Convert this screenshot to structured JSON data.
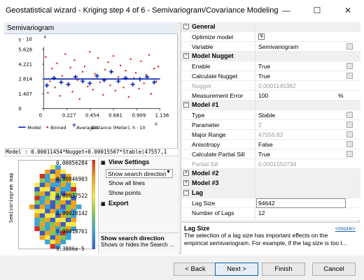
{
  "window": {
    "title": "Geostatistical wizard - Kriging step 4 of 6 - Semivariogram/Covariance Modeling",
    "controls": {
      "minimize": "—",
      "maximize": "☐",
      "close": "✕"
    }
  },
  "semivariogram_panel": {
    "header": "Semivariogram",
    "y_scale": "γ · 10",
    "y_exp": "4",
    "x_scale": "Distance (Meter), h · 10",
    "x_exp": "-6",
    "legend": {
      "model": "Model",
      "binned": "Binned",
      "averaged": "Averaged"
    },
    "model_equation": "Model : 0.00011454*Nugget+0.00015507*Stable(47557,1",
    "chart_data": {
      "type": "scatter",
      "y_ticks": [
        "5.628",
        "4.221",
        "2.814",
        "1.407",
        "0"
      ],
      "x_ticks": [
        "0",
        "0.227",
        "0.454",
        "0.681",
        "0.909",
        "1.136"
      ],
      "model_value": 2.814,
      "xlim": [
        0,
        1.136
      ],
      "ylim": [
        0,
        5.628
      ],
      "binned": [
        {
          "x": 0.02,
          "y": 4.9
        },
        {
          "x": 0.04,
          "y": 1.5
        },
        {
          "x": 0.06,
          "y": 2.6
        },
        {
          "x": 0.08,
          "y": 3.8
        },
        {
          "x": 0.11,
          "y": 2.0
        },
        {
          "x": 0.13,
          "y": 4.3
        },
        {
          "x": 0.16,
          "y": 1.2
        },
        {
          "x": 0.18,
          "y": 3.1
        },
        {
          "x": 0.21,
          "y": 5.2
        },
        {
          "x": 0.23,
          "y": 2.3
        },
        {
          "x": 0.26,
          "y": 3.9
        },
        {
          "x": 0.28,
          "y": 1.6
        },
        {
          "x": 0.3,
          "y": 4.6
        },
        {
          "x": 0.33,
          "y": 2.7
        },
        {
          "x": 0.35,
          "y": 0.9
        },
        {
          "x": 0.38,
          "y": 3.5
        },
        {
          "x": 0.4,
          "y": 4.0
        },
        {
          "x": 0.43,
          "y": 2.1
        },
        {
          "x": 0.45,
          "y": 5.4
        },
        {
          "x": 0.48,
          "y": 1.8
        },
        {
          "x": 0.5,
          "y": 3.3
        },
        {
          "x": 0.53,
          "y": 4.8
        },
        {
          "x": 0.55,
          "y": 2.5
        },
        {
          "x": 0.58,
          "y": 1.3
        },
        {
          "x": 0.6,
          "y": 3.7
        },
        {
          "x": 0.63,
          "y": 4.4
        },
        {
          "x": 0.65,
          "y": 2.2
        },
        {
          "x": 0.68,
          "y": 5.0
        },
        {
          "x": 0.7,
          "y": 1.7
        },
        {
          "x": 0.73,
          "y": 3.0
        },
        {
          "x": 0.75,
          "y": 4.1
        },
        {
          "x": 0.78,
          "y": 2.0
        },
        {
          "x": 0.8,
          "y": 3.6
        },
        {
          "x": 0.83,
          "y": 1.1
        },
        {
          "x": 0.85,
          "y": 4.7
        },
        {
          "x": 0.88,
          "y": 2.9
        },
        {
          "x": 0.9,
          "y": 3.4
        },
        {
          "x": 0.93,
          "y": 1.9
        },
        {
          "x": 0.95,
          "y": 4.5
        },
        {
          "x": 0.98,
          "y": 2.4
        },
        {
          "x": 1.0,
          "y": 3.2
        },
        {
          "x": 1.03,
          "y": 5.1
        },
        {
          "x": 1.05,
          "y": 1.4
        },
        {
          "x": 1.08,
          "y": 3.8
        },
        {
          "x": 1.1,
          "y": 2.6
        },
        {
          "x": 1.12,
          "y": 4.0
        }
      ],
      "averaged": [
        {
          "x": 0.03,
          "y": 2.2
        },
        {
          "x": 0.1,
          "y": 2.9
        },
        {
          "x": 0.17,
          "y": 2.5
        },
        {
          "x": 0.24,
          "y": 2.3
        },
        {
          "x": 0.31,
          "y": 3.0
        },
        {
          "x": 0.38,
          "y": 2.6
        },
        {
          "x": 0.45,
          "y": 2.4
        },
        {
          "x": 0.52,
          "y": 3.1
        },
        {
          "x": 0.59,
          "y": 2.7
        },
        {
          "x": 0.66,
          "y": 3.5
        },
        {
          "x": 0.73,
          "y": 2.6
        },
        {
          "x": 0.8,
          "y": 2.9
        },
        {
          "x": 0.87,
          "y": 2.3
        },
        {
          "x": 0.94,
          "y": 2.8
        },
        {
          "x": 1.01,
          "y": 3.0
        },
        {
          "x": 1.08,
          "y": 2.5
        }
      ]
    }
  },
  "map_panel": {
    "ylabel": "Semivariogram map",
    "values": [
      "0.00056284",
      "0.00046903",
      "0.00037522",
      "0.00028142",
      "0.00018761",
      "9.3806e-5"
    ]
  },
  "view_settings": {
    "title": "View Settings",
    "dropdown_value": "Show search direction",
    "items": [
      "Show all lines",
      "Show points"
    ],
    "export": "Export",
    "desc_title": "Show search direction",
    "desc_text": "Shows or hides the Search ..."
  },
  "properties": {
    "general": "General",
    "optimize_model_label": "Optimize model",
    "variable_label": "Variable",
    "variable_value": "Semivariogram",
    "model_nugget": "Model Nugget",
    "enable_label": "Enable",
    "enable_value": "True",
    "calc_nugget_label": "Calculate Nugget",
    "calc_nugget_value": "True",
    "nugget_label": "Nugget",
    "nugget_value": "0.0001145382",
    "measurement_error_label": "Measurement Error",
    "measurement_error_value": "100",
    "measurement_error_unit": "%",
    "model1": "Model #1",
    "type_label": "Type",
    "type_value": "Stable",
    "parameter_label": "Parameter",
    "parameter_value": "2",
    "major_range_label": "Major Range",
    "major_range_value": "47556.82",
    "anisotropy_label": "Anisotropy",
    "anisotropy_value": "False",
    "calc_partial_sill_label": "Calculate Partial Sill",
    "calc_partial_sill_value": "True",
    "partial_sill_label": "Partial Sill",
    "partial_sill_value": "0.0001550734",
    "model2": "Model #2",
    "model3": "Model #3",
    "lag": "Lag",
    "lag_size_label": "Lag Size",
    "lag_size_value": "94642",
    "num_lags_label": "Number of Lags",
    "num_lags_value": "12"
  },
  "description": {
    "title": "Lag Size",
    "more": "<more>",
    "line1": "The selection of a lag size has important effects on the",
    "line2": "empirical semivariogram. For example, if the lag size is too l..."
  },
  "buttons": {
    "back": "< Back",
    "next": "Next >",
    "finish": "Finish",
    "cancel": "Cancel"
  }
}
